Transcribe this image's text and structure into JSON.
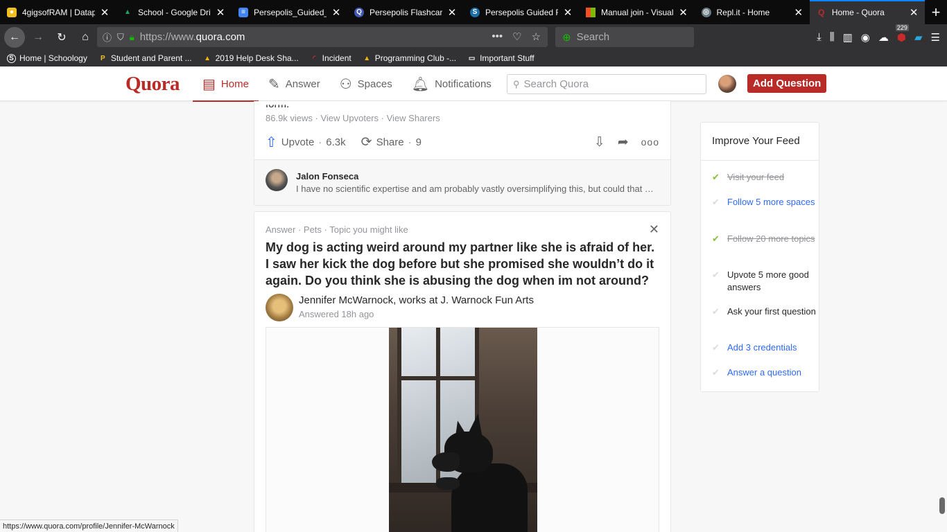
{
  "browser": {
    "tabs": [
      {
        "title": "4gigsofRAM | Datap",
        "icon": "pixel-icon",
        "color": "#f0c020"
      },
      {
        "title": "School - Google Driv",
        "icon": "google-drive-icon",
        "color": "#1fa463"
      },
      {
        "title": "Persepolis_Guided_R",
        "icon": "google-docs-icon",
        "color": "#4285f4"
      },
      {
        "title": "Persepolis Flashcard",
        "icon": "quizlet-icon",
        "color": "#4257b2"
      },
      {
        "title": "Persepolis Guided R",
        "icon": "schoology-icon",
        "color": "#1b6ea8"
      },
      {
        "title": "Manual join - Visual",
        "icon": "microsoft-icon",
        "color": "#f25022"
      },
      {
        "title": "Repl.it - Home",
        "icon": "replit-icon",
        "color": "#667881"
      },
      {
        "title": "Home - Quora",
        "icon": "quora-icon",
        "color": "#b92b27",
        "active": true
      }
    ],
    "url_prefix": "https://www.",
    "url_domain": "quora.com",
    "search_placeholder": "Search",
    "notification_count": "229",
    "bookmarks": [
      {
        "label": "Home | Schoology",
        "icon": "schoology-icon"
      },
      {
        "label": "Student and Parent ...",
        "icon": "powerschool-icon"
      },
      {
        "label": "2019 Help Desk Sha...",
        "icon": "google-drive-icon"
      },
      {
        "label": "Incident",
        "icon": "incident-icon"
      },
      {
        "label": "Programming Club -...",
        "icon": "google-drive-icon"
      },
      {
        "label": "Important Stuff",
        "icon": "folder-icon"
      }
    ],
    "status_url": "https://www.quora.com/profile/Jennifer-McWarnock"
  },
  "header": {
    "logo": "Quora",
    "nav": [
      {
        "label": "Home",
        "icon": "home-feed-icon",
        "active": true
      },
      {
        "label": "Answer",
        "icon": "pencil-icon"
      },
      {
        "label": "Spaces",
        "icon": "people-icon"
      },
      {
        "label": "Notifications",
        "icon": "bell-icon"
      }
    ],
    "search_placeholder": "Search Quora",
    "add_question": "Add Question"
  },
  "feed": {
    "prev_card": {
      "cut_text": "form.",
      "views": "86.9k views",
      "view_upvoters": "View Upvoters",
      "view_sharers": "View Sharers",
      "upvote_label": "Upvote",
      "upvote_count": "6.3k",
      "share_label": "Share",
      "share_count": "9",
      "comment": {
        "author": "Jalon Fonseca",
        "text": "I have no scientific expertise and am probably vastly oversimplifying this, but could that be a reason why it"
      }
    },
    "card": {
      "meta": "Answer · Pets · Topic you might like",
      "question": "My dog is acting weird around my partner like she is afraid of her. I saw her kick the dog before but she promised she wouldn’t do it again. Do you think she is abusing the dog when im not around?",
      "author_line": "Jennifer McWarnock, works at J. Warnock Fun Arts",
      "answered": "Answered 18h ago"
    }
  },
  "sidebar": {
    "title": "Improve Your Feed",
    "items": [
      {
        "label": "Visit your feed",
        "state": "done"
      },
      {
        "label": "Follow 5 more spaces",
        "state": "link"
      },
      {
        "label": "Follow 20 more topics",
        "state": "done"
      },
      {
        "label": "Upvote 5 more good answers",
        "state": "plain"
      },
      {
        "label": "Ask your first question",
        "state": "plain"
      },
      {
        "label": "Add 3 credentials",
        "state": "link"
      },
      {
        "label": "Answer a question",
        "state": "link"
      }
    ]
  }
}
